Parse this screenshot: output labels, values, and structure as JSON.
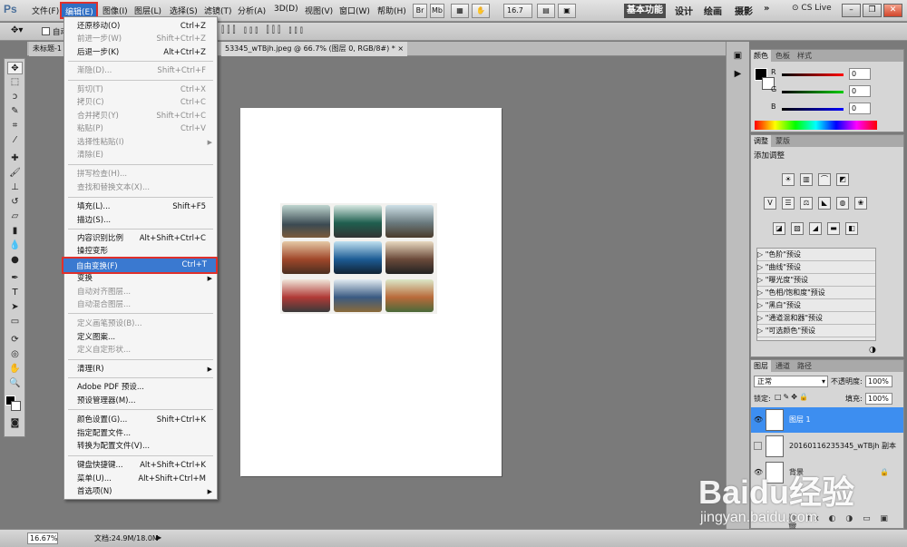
{
  "menubar": {
    "logo": "Ps",
    "items": [
      "文件(F)",
      "编辑(E)",
      "图像(I)",
      "图层(L)",
      "选择(S)",
      "滤镜(T)",
      "分析(A)",
      "3D(D)",
      "视图(V)",
      "窗口(W)",
      "帮助(H)"
    ],
    "zoom": "16.7",
    "workspaces": [
      "基本功能",
      "设计",
      "绘画",
      "摄影"
    ],
    "more": "»",
    "cslive": "CS Live"
  },
  "optionsbar": {
    "auto_select": "自动"
  },
  "doc": {
    "tab1": "未标题-1",
    "tab2": "53345_wTBjh.jpeg @ 66.7% (图层 0, RGB/8#) *",
    "close": "×"
  },
  "editmenu": {
    "items": [
      {
        "label": "还原移动(O)",
        "shortcut": "Ctrl+Z",
        "disabled": false
      },
      {
        "label": "前进一步(W)",
        "shortcut": "Shift+Ctrl+Z",
        "disabled": true
      },
      {
        "label": "后退一步(K)",
        "shortcut": "Alt+Ctrl+Z",
        "disabled": false
      },
      {
        "label": "渐隐(D)...",
        "shortcut": "Shift+Ctrl+F",
        "disabled": true
      },
      {
        "label": "剪切(T)",
        "shortcut": "Ctrl+X",
        "disabled": true
      },
      {
        "label": "拷贝(C)",
        "shortcut": "Ctrl+C",
        "disabled": true
      },
      {
        "label": "合并拷贝(Y)",
        "shortcut": "Shift+Ctrl+C",
        "disabled": true
      },
      {
        "label": "粘贴(P)",
        "shortcut": "Ctrl+V",
        "disabled": true
      },
      {
        "label": "选择性粘贴(I)",
        "shortcut": "",
        "disabled": true,
        "submenu": true
      },
      {
        "label": "清除(E)",
        "shortcut": "",
        "disabled": true
      },
      {
        "label": "拼写检查(H)...",
        "shortcut": "",
        "disabled": true
      },
      {
        "label": "查找和替换文本(X)...",
        "shortcut": "",
        "disabled": true
      },
      {
        "label": "填充(L)...",
        "shortcut": "Shift+F5",
        "disabled": false
      },
      {
        "label": "描边(S)...",
        "shortcut": "",
        "disabled": false
      },
      {
        "label": "内容识别比例",
        "shortcut": "Alt+Shift+Ctrl+C",
        "disabled": false
      },
      {
        "label": "操控变形",
        "shortcut": "",
        "disabled": false
      },
      {
        "label": "自由变换(F)",
        "shortcut": "Ctrl+T",
        "disabled": false,
        "highlighted": true
      },
      {
        "label": "变换",
        "shortcut": "",
        "disabled": false,
        "submenu": true
      },
      {
        "label": "自动对齐图层...",
        "shortcut": "",
        "disabled": true
      },
      {
        "label": "自动混合图层...",
        "shortcut": "",
        "disabled": true
      },
      {
        "label": "定义画笔预设(B)...",
        "shortcut": "",
        "disabled": true
      },
      {
        "label": "定义图案...",
        "shortcut": "",
        "disabled": false
      },
      {
        "label": "定义自定形状...",
        "shortcut": "",
        "disabled": true
      },
      {
        "label": "清理(R)",
        "shortcut": "",
        "disabled": false,
        "submenu": true
      },
      {
        "label": "Adobe PDF 预设...",
        "shortcut": "",
        "disabled": false
      },
      {
        "label": "预设管理器(M)...",
        "shortcut": "",
        "disabled": false
      },
      {
        "label": "颜色设置(G)...",
        "shortcut": "Shift+Ctrl+K",
        "disabled": false
      },
      {
        "label": "指定配置文件...",
        "shortcut": "",
        "disabled": false
      },
      {
        "label": "转换为配置文件(V)...",
        "shortcut": "",
        "disabled": false
      },
      {
        "label": "键盘快捷键...",
        "shortcut": "Alt+Shift+Ctrl+K",
        "disabled": false
      },
      {
        "label": "菜单(U)...",
        "shortcut": "Alt+Shift+Ctrl+M",
        "disabled": false
      },
      {
        "label": "首选项(N)",
        "shortcut": "",
        "disabled": false,
        "submenu": true
      }
    ]
  },
  "color_panel": {
    "tabs": [
      "颜色",
      "色板",
      "样式"
    ],
    "r_label": "R",
    "g_label": "G",
    "b_label": "B",
    "r": "0",
    "g": "0",
    "b": "0"
  },
  "adjust_panel": {
    "tabs": [
      "调整",
      "蒙版"
    ],
    "title": "添加调整",
    "presets": [
      "\"色阶\"预设",
      "\"曲线\"预设",
      "\"曝光度\"预设",
      "\"色相/饱和度\"预设",
      "\"黑白\"预设",
      "\"通道混和器\"预设",
      "\"可选颜色\"预设"
    ]
  },
  "layers_panel": {
    "tabs": [
      "图层",
      "通道",
      "路径"
    ],
    "blend_mode": "正常",
    "opacity_label": "不透明度:",
    "opacity": "100%",
    "lock_label": "锁定:",
    "fill_label": "填充:",
    "fill": "100%",
    "layers": [
      {
        "name": "图层 1",
        "selected": true
      },
      {
        "name": "20160116235345_wTBjh 副本",
        "selected": false
      },
      {
        "name": "背景",
        "selected": false
      }
    ]
  },
  "status": {
    "zoom": "16.67%",
    "doc_size": "文档:24.9M/18.0M"
  },
  "watermark": {
    "brand": "Baidu经验",
    "url": "jingyan.baidu.com"
  },
  "colors": {
    "menu_highlight": "#3a79d0",
    "annotation_red": "#e0302b",
    "layer_selected": "#3d8ef0"
  }
}
